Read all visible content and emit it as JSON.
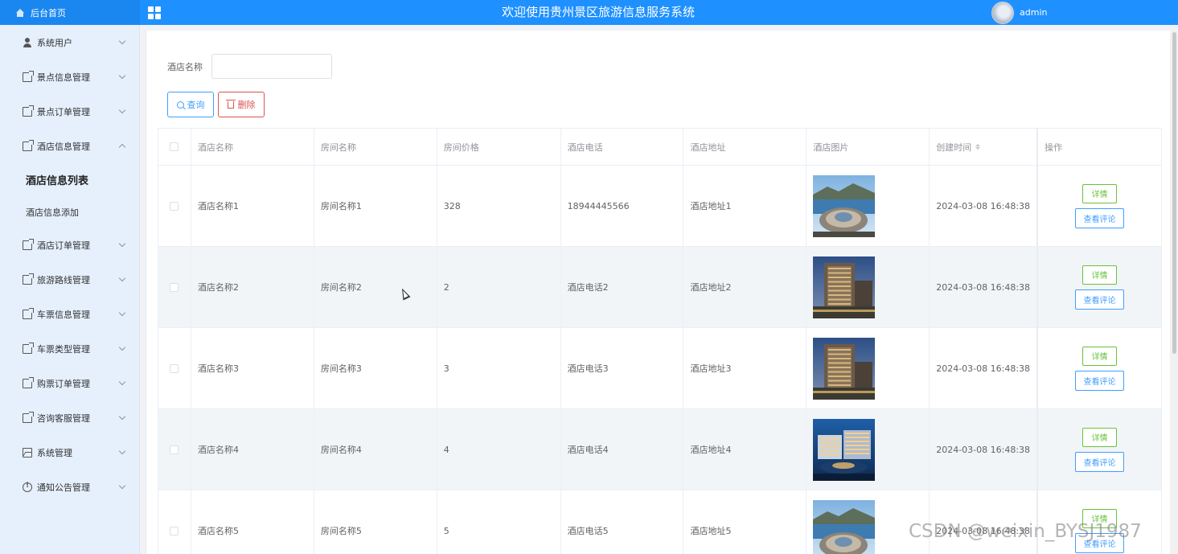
{
  "topbar": {
    "home_label": "后台首页",
    "title": "欢迎使用贵州景区旅游信息服务系统",
    "user": "admin",
    "colors": {
      "bar": "#1e90ff"
    }
  },
  "sidebar": {
    "items": [
      {
        "label": "系统用户",
        "icon": "user-icon"
      },
      {
        "label": "景点信息管理",
        "icon": "document-icon"
      },
      {
        "label": "景点订单管理",
        "icon": "document-icon"
      },
      {
        "label": "酒店信息管理",
        "icon": "document-icon",
        "expanded": true,
        "children": [
          {
            "label": "酒店信息列表",
            "active": true
          },
          {
            "label": "酒店信息添加"
          }
        ]
      },
      {
        "label": "酒店订单管理",
        "icon": "document-icon"
      },
      {
        "label": "旅游路线管理",
        "icon": "document-icon"
      },
      {
        "label": "车票信息管理",
        "icon": "document-icon"
      },
      {
        "label": "车票类型管理",
        "icon": "document-icon"
      },
      {
        "label": "购票订单管理",
        "icon": "document-icon"
      },
      {
        "label": "咨询客服管理",
        "icon": "document-icon"
      },
      {
        "label": "系统管理",
        "icon": "picture-icon"
      },
      {
        "label": "通知公告管理",
        "icon": "info-icon"
      }
    ]
  },
  "search": {
    "label": "酒店名称",
    "value": "",
    "placeholder": "",
    "query_button": "查询",
    "delete_button": "删除"
  },
  "table": {
    "headers": [
      "酒店名称",
      "房间名称",
      "房间价格",
      "酒店电话",
      "酒店地址",
      "酒店图片",
      "创建时间",
      "操作"
    ],
    "rows": [
      {
        "hotel": "酒店名称1",
        "room": "房间名称1",
        "price": "328",
        "phone": "18944445566",
        "address": "酒店地址1",
        "image": "hotel-photo-lake",
        "created": "2024-03-08 16:48:38"
      },
      {
        "hotel": "酒店名称2",
        "room": "房间名称2",
        "price": "2",
        "phone": "酒店电话2",
        "address": "酒店地址2",
        "image": "hotel-photo-tower",
        "created": "2024-03-08 16:48:38"
      },
      {
        "hotel": "酒店名称3",
        "room": "房间名称3",
        "price": "3",
        "phone": "酒店电话3",
        "address": "酒店地址3",
        "image": "hotel-photo-tower",
        "created": "2024-03-08 16:48:38"
      },
      {
        "hotel": "酒店名称4",
        "room": "房间名称4",
        "price": "4",
        "phone": "酒店电话4",
        "address": "酒店地址4",
        "image": "hotel-photo-night",
        "created": "2024-03-08 16:48:38"
      },
      {
        "hotel": "酒店名称5",
        "room": "房间名称5",
        "price": "5",
        "phone": "酒店电话5",
        "address": "酒店地址5",
        "image": "hotel-photo-lake",
        "created": "2024-03-08 16:48:38"
      }
    ],
    "detail_button": "详情",
    "review_button": "查看评论"
  },
  "watermark": "CSDN @weixin_BYSJ1987"
}
